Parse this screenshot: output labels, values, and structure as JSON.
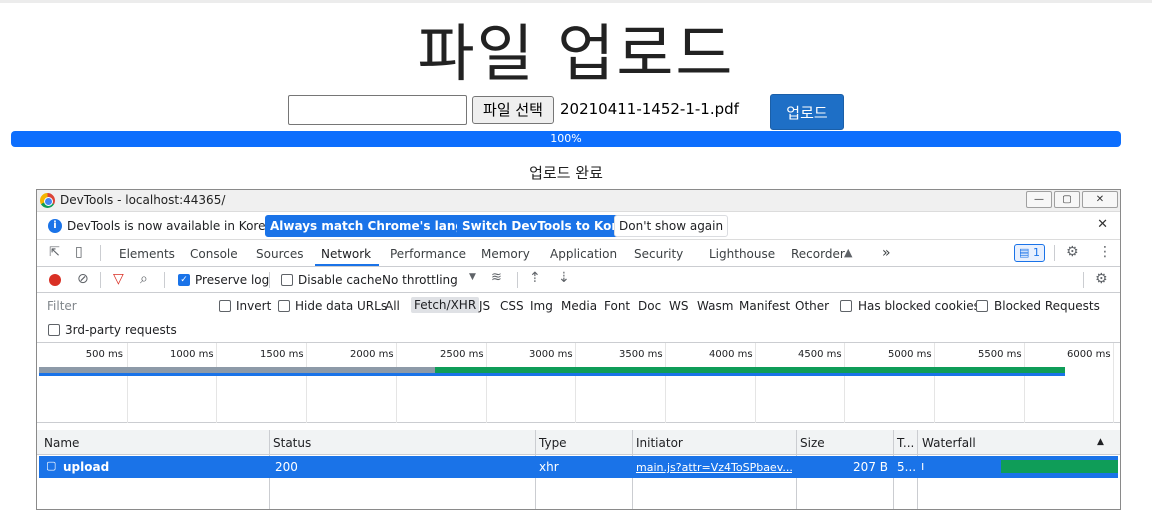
{
  "page": {
    "title": "파일 업로드",
    "file_button": "파일 선택",
    "file_name": "20210411-1452-1-1.pdf",
    "upload_button": "업로드",
    "progress_percent": 100,
    "progress_label": "100%",
    "status": "업로드 완료"
  },
  "devtools": {
    "window_title": "DevTools - localhost:44365/",
    "window_buttons": [
      "—",
      "▢",
      "✕"
    ],
    "infobar": {
      "message": "DevTools is now available in Korean!",
      "btn_match": "Always match Chrome's language",
      "btn_switch": "Switch DevTools to Korean",
      "btn_dismiss": "Don't show again"
    },
    "tabs": [
      "Elements",
      "Console",
      "Sources",
      "Network",
      "Performance",
      "Memory",
      "Application",
      "Security",
      "Lighthouse",
      "Recorder"
    ],
    "active_tab": "Network",
    "more_tabs": "»",
    "issues_count": "1",
    "toolbar": {
      "preserve_log": "Preserve log",
      "disable_cache": "Disable cache",
      "throttling": "No throttling"
    },
    "filter": {
      "placeholder": "Filter",
      "invert": "Invert",
      "hide_data_urls": "Hide data URLs",
      "types": [
        "All",
        "Fetch/XHR",
        "JS",
        "CSS",
        "Img",
        "Media",
        "Font",
        "Doc",
        "WS",
        "Wasm",
        "Manifest",
        "Other"
      ],
      "active_type": "Fetch/XHR",
      "has_blocked_cookies": "Has blocked cookies",
      "blocked_requests": "Blocked Requests",
      "third_party": "3rd-party requests"
    },
    "overview_ticks": [
      "500 ms",
      "1000 ms",
      "1500 ms",
      "2000 ms",
      "2500 ms",
      "3000 ms",
      "3500 ms",
      "4000 ms",
      "4500 ms",
      "5000 ms",
      "5500 ms",
      "6000 ms"
    ],
    "columns": {
      "name": "Name",
      "status": "Status",
      "type": "Type",
      "initiator": "Initiator",
      "size": "Size",
      "time": "T...",
      "waterfall": "Waterfall"
    },
    "rows": [
      {
        "name": "upload",
        "status": "200",
        "type": "xhr",
        "initiator": "main.js?attr=Vz4ToSPbaev...",
        "size": "207 B",
        "time": "5..."
      }
    ]
  }
}
